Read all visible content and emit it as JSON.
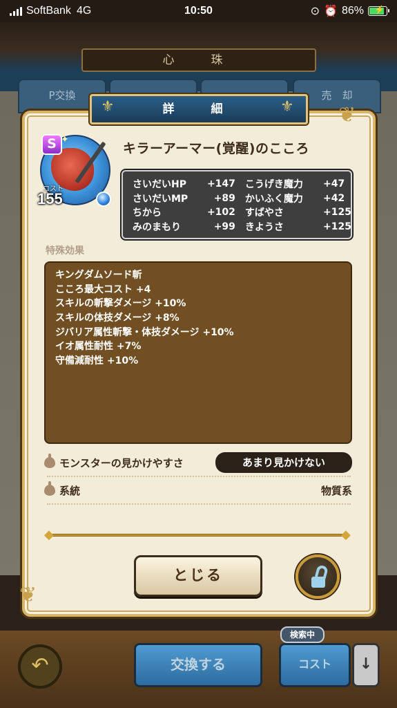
{
  "status_bar": {
    "carrier": "SoftBank",
    "network": "4G",
    "time": "10:50",
    "battery": "86%",
    "battery_level": 0.86
  },
  "background": {
    "title": "心　珠",
    "tabs": [
      "P交換",
      "",
      "",
      "売　却"
    ],
    "exchange_button": "交換する",
    "cost_button": "コスト",
    "search_tag": "検索中",
    "back_icon": "return-arrow-icon",
    "sort_icon": "down-arrow-icon"
  },
  "modal": {
    "title": "詳　細",
    "item": {
      "name": "キラーアーマー(覚醒)のこころ",
      "rank": "S",
      "cost_label": "コスト",
      "cost": "155",
      "element_color": "#2a7fe0"
    },
    "stats": [
      {
        "name": "さいだいHP",
        "value": "+147",
        "name2": "こうげき魔力",
        "value2": "+47"
      },
      {
        "name": "さいだいMP",
        "value": "+89",
        "name2": "かいふく魔力",
        "value2": "+42"
      },
      {
        "name": "ちから",
        "value": "+102",
        "name2": "すばやさ",
        "value2": "+125"
      },
      {
        "name": "みのまもり",
        "value": "+99",
        "name2": "きようさ",
        "value2": "+125"
      }
    ],
    "special_label": "特殊効果",
    "effects": [
      "キングダムソード斬",
      "こころ最大コスト +4",
      "スキルの斬撃ダメージ +10%",
      "スキルの体技ダメージ +8%",
      "ジバリア属性斬撃・体技ダメージ +10%",
      "イオ属性耐性 +7%",
      "守備減耐性 +10%"
    ],
    "visibility_label": "モンスターの見かけやすさ",
    "visibility_value": "あまり見かけない",
    "family_label": "系統",
    "family_value": "物質系",
    "close_button": "とじる",
    "lock_icon": "unlocked-padlock-icon"
  },
  "colors": {
    "header_blue": "#1b3c58",
    "frame_gold": "#d7b66a",
    "effect_box": "#714f22",
    "stat_box": "#3e3e3e"
  }
}
